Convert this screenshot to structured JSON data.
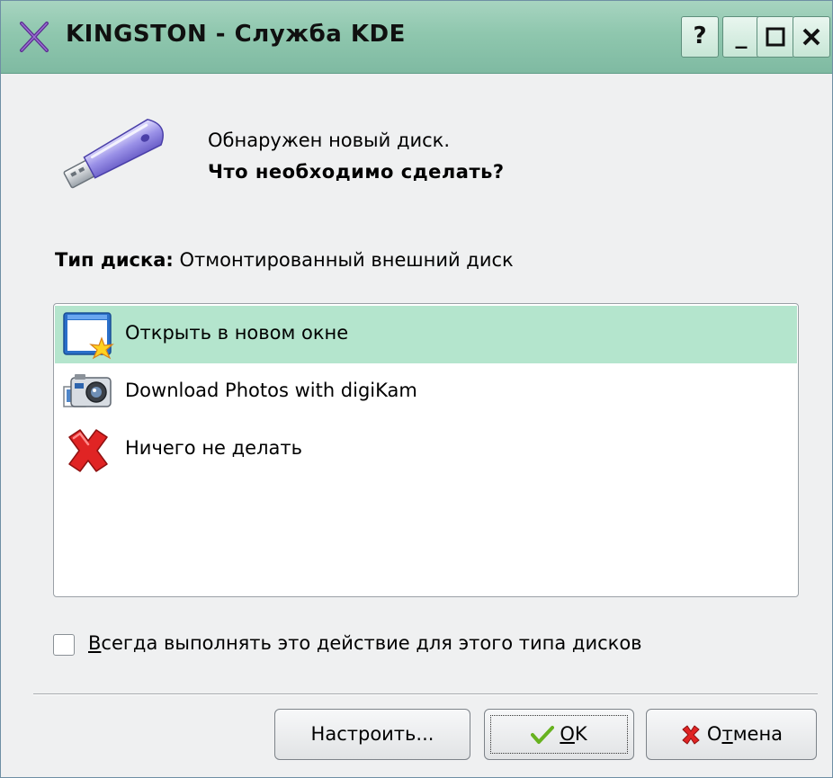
{
  "window": {
    "title": "KINGSTON - Служба KDE",
    "controls": {
      "help": "?",
      "minimize": "_",
      "maximize": "□",
      "close": "✕"
    }
  },
  "message": {
    "line1": "Обнаружен новый диск.",
    "line2": "Что необходимо сделать?"
  },
  "disk_type": {
    "label": "Тип диска:",
    "value": "Отмонтированный внешний диск"
  },
  "actions": [
    {
      "label": "Открыть в новом окне",
      "icon": "new-window-icon",
      "selected": true
    },
    {
      "label": "Download Photos with digiKam",
      "icon": "digikam-camera-icon",
      "selected": false
    },
    {
      "label": "Ничего не делать",
      "icon": "red-x-icon",
      "selected": false
    }
  ],
  "always": {
    "checked": false,
    "accel": "В",
    "rest": "сегда выполнять это действие для этого типа дисков"
  },
  "buttons": {
    "configure": "Настроить...",
    "ok_accel": "O",
    "ok_rest": "K",
    "cancel_pre": "О",
    "cancel_accel": "т",
    "cancel_rest": "мена"
  },
  "colors": {
    "titlebar": "#8fc7ae",
    "selection": "#b4e5cd",
    "window_bg": "#eff0f1"
  }
}
